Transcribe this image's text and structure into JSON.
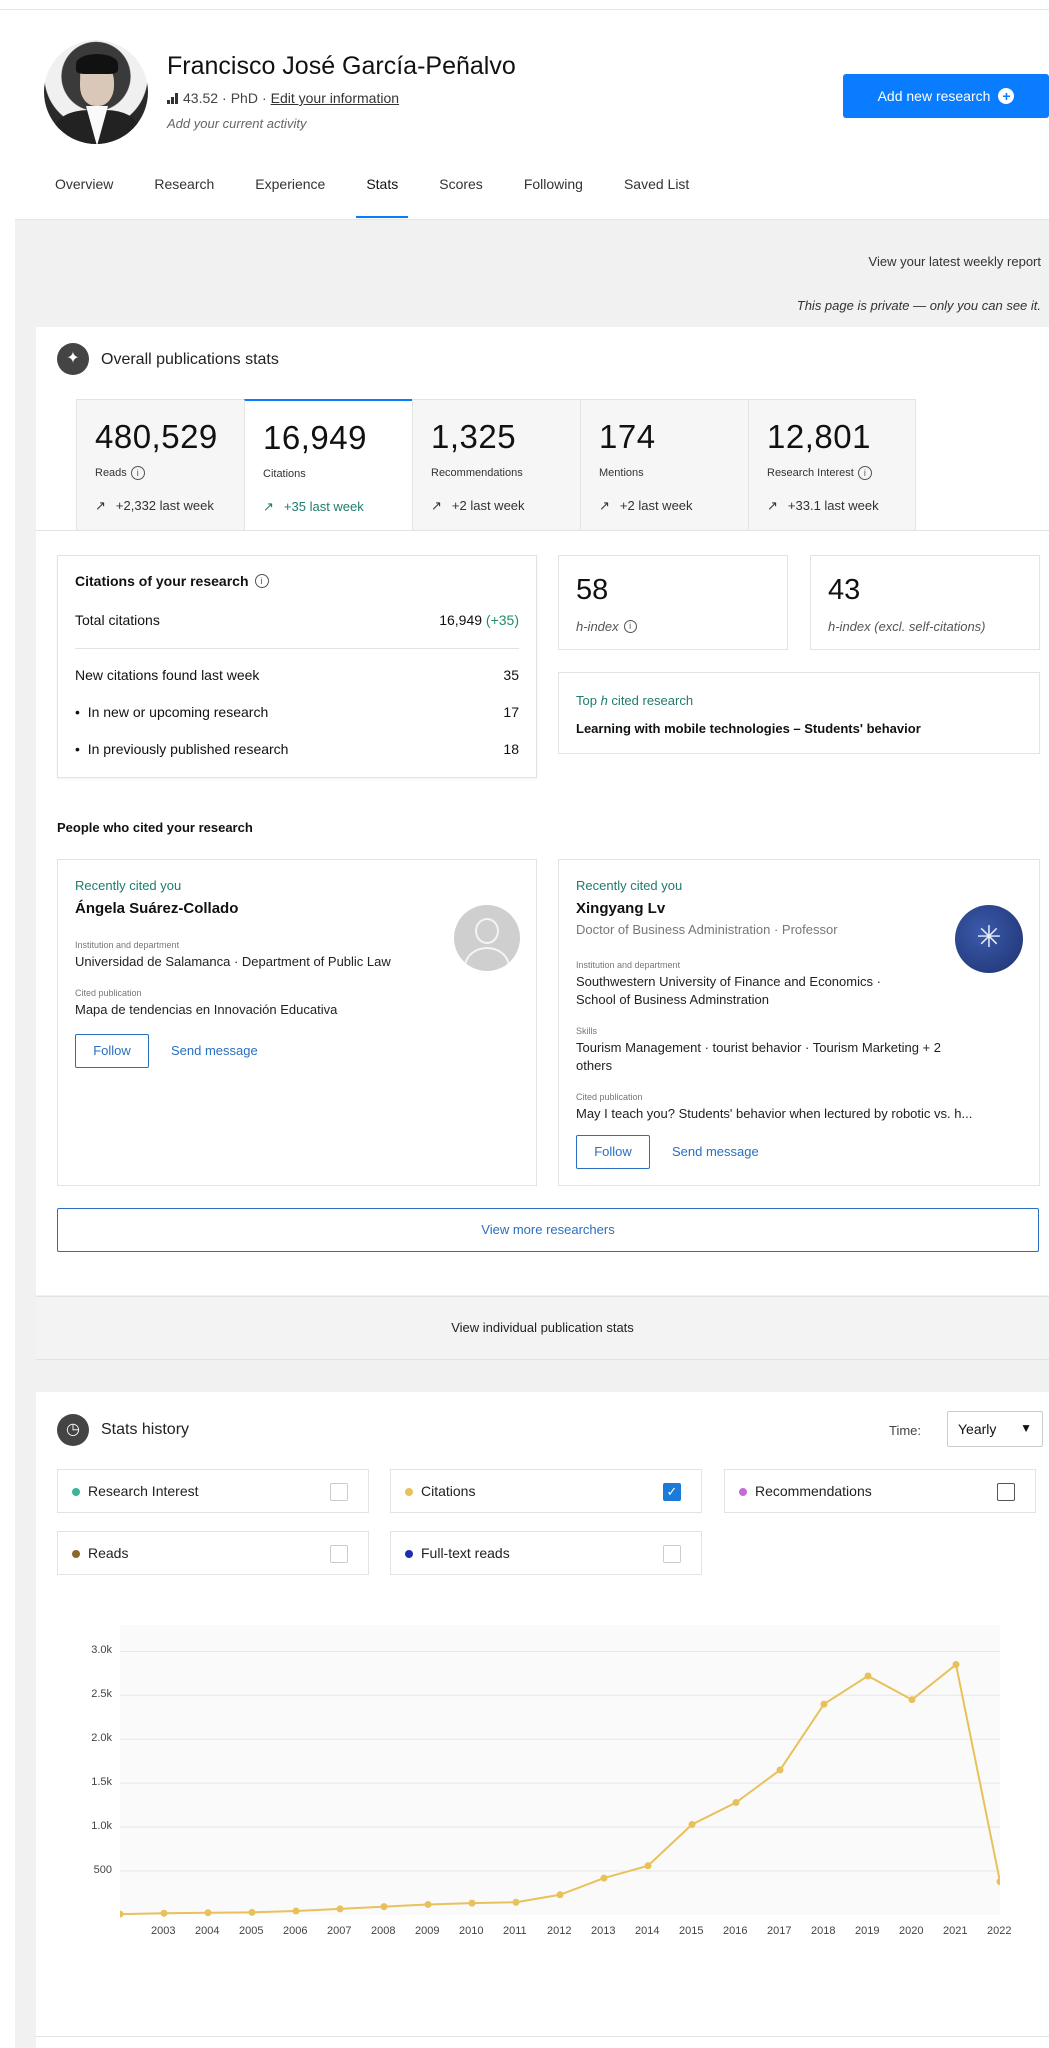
{
  "profile": {
    "name": "Francisco José García-Peñalvo",
    "score": "43.52",
    "degree": "PhD",
    "edit_link": "Edit your information",
    "activity_placeholder": "Add your current activity",
    "add_research": "Add new research"
  },
  "tabs": [
    "Overview",
    "Research",
    "Experience",
    "Stats",
    "Scores",
    "Following",
    "Saved List"
  ],
  "active_tab": "Stats",
  "weekly_report": "View your latest weekly report",
  "private_note": "This page is private — only you can see it.",
  "overall": {
    "title": "Overall publications stats",
    "stats": [
      {
        "num": "480,529",
        "label": "Reads",
        "week": "+2,332 last week",
        "info": true
      },
      {
        "num": "16,949",
        "label": "Citations",
        "week": "+35 last week",
        "info": false
      },
      {
        "num": "1,325",
        "label": "Recommendations",
        "week": "+2 last week",
        "info": false
      },
      {
        "num": "174",
        "label": "Mentions",
        "week": "+2 last week",
        "info": false
      },
      {
        "num": "12,801",
        "label": "Research Interest",
        "week": "+33.1 last week",
        "info": true
      }
    ]
  },
  "citations": {
    "title": "Citations of your research",
    "total_label": "Total citations",
    "total_value": "16,949",
    "total_delta": "(+35)",
    "new_label": "New citations found last week",
    "new_value": "35",
    "upcoming_label": "In new or upcoming research",
    "upcoming_value": "17",
    "published_label": "In previously published research",
    "published_value": "18"
  },
  "hindex": {
    "value": "58",
    "label": "h-index"
  },
  "hindex_excl": {
    "value": "43",
    "label": "h-index (excl. self-citations)"
  },
  "top_cited": {
    "label_pre": "Top ",
    "label_h": "h",
    "label_post": " cited research",
    "title": "Learning with mobile technologies – Students' behavior"
  },
  "people": {
    "title": "People who cited your research",
    "cards": [
      {
        "recent": "Recently cited you",
        "name": "Ángela Suárez-Collado",
        "inst_label": "Institution and department",
        "inst": "Universidad de Salamanca · Department of Public Law",
        "pub_label": "Cited publication",
        "pub": "Mapa de tendencias en Innovación Educativa",
        "follow": "Follow",
        "message": "Send message"
      },
      {
        "recent": "Recently cited you",
        "name": "Xingyang Lv",
        "subtitle": "Doctor of Business Administration · Professor",
        "inst_label": "Institution and department",
        "inst": "Southwestern University of Finance and Economics ·",
        "inst2": "School of Business Adminstration",
        "skills_label": "Skills",
        "skills": "Tourism Management · tourist behavior · Tourism Marketing + 2",
        "skills2": "others",
        "pub_label": "Cited publication",
        "pub": "May I teach you? Students' behavior when lectured by robotic vs. h...",
        "follow": "Follow",
        "message": "Send message"
      }
    ],
    "view_more": "View more researchers"
  },
  "individual_stats": "View individual publication stats",
  "history": {
    "title": "Stats history",
    "time_label": "Time:",
    "time_value": "Yearly",
    "legend": [
      {
        "name": "Research Interest",
        "color": "#39b59a",
        "checked": false
      },
      {
        "name": "Citations",
        "color": "#e8c15a",
        "checked": true
      },
      {
        "name": "Recommendations",
        "color": "#c56ad6",
        "checked": false
      },
      {
        "name": "Reads",
        "color": "#8a6a2a",
        "checked": false
      },
      {
        "name": "Full-text reads",
        "color": "#1b2fb0",
        "checked": false
      }
    ]
  },
  "chart_data": {
    "type": "line",
    "title": "",
    "xlabel": "",
    "ylabel": "",
    "x": [
      2002,
      2003,
      2004,
      2005,
      2006,
      2007,
      2008,
      2009,
      2010,
      2011,
      2012,
      2013,
      2014,
      2015,
      2016,
      2017,
      2018,
      2019,
      2020,
      2021,
      2022
    ],
    "x_tick_labels": [
      "2003",
      "2004",
      "2005",
      "2006",
      "2007",
      "2008",
      "2009",
      "2010",
      "2011",
      "2012",
      "2013",
      "2014",
      "2015",
      "2016",
      "2017",
      "2018",
      "2019",
      "2020",
      "2021",
      "2022"
    ],
    "series": [
      {
        "name": "Citations",
        "color": "#e8c15a",
        "values": [
          10,
          20,
          25,
          30,
          45,
          70,
          95,
          120,
          135,
          145,
          230,
          420,
          560,
          1030,
          1280,
          1650,
          2400,
          2720,
          2450,
          2850,
          380
        ]
      }
    ],
    "y_ticks": [
      "500",
      "1.0k",
      "1.5k",
      "2.0k",
      "2.5k",
      "3.0k"
    ],
    "ylim": [
      0,
      3300
    ],
    "grid": true
  }
}
